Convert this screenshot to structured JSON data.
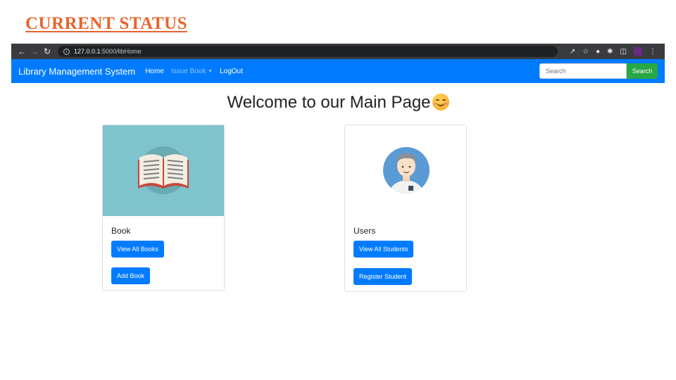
{
  "slide": {
    "title": "CURRENT STATUS"
  },
  "browser": {
    "url_host": "127.0.0.1",
    "url_path": ":5000/libHome"
  },
  "navbar": {
    "brand": "Library Management System",
    "links": [
      {
        "label": "Home"
      },
      {
        "label": "Issue Book"
      },
      {
        "label": "LogOut"
      }
    ],
    "search_placeholder": "Search",
    "search_button": "Search"
  },
  "main": {
    "heading": "Welcome to our Main Page"
  },
  "cards": {
    "book": {
      "title": "Book",
      "buttons": [
        "View All Books",
        "Add Book"
      ]
    },
    "users": {
      "title": "Users",
      "buttons": [
        "View All Students",
        "Register Student"
      ]
    }
  },
  "colors": {
    "accent": "#007bff",
    "search": "#28a745",
    "slide_title": "#e8642c",
    "book_bg": "#7fc3cc"
  },
  "icons": [
    "back-arrow-icon",
    "forward-arrow-icon",
    "reload-icon",
    "info-icon",
    "share-icon",
    "star-icon",
    "extension-icon",
    "puzzle-icon",
    "sidebar-icon",
    "profile-icon",
    "kebab-menu-icon",
    "smiling-emoji-icon",
    "open-book-icon",
    "user-avatar-icon"
  ]
}
